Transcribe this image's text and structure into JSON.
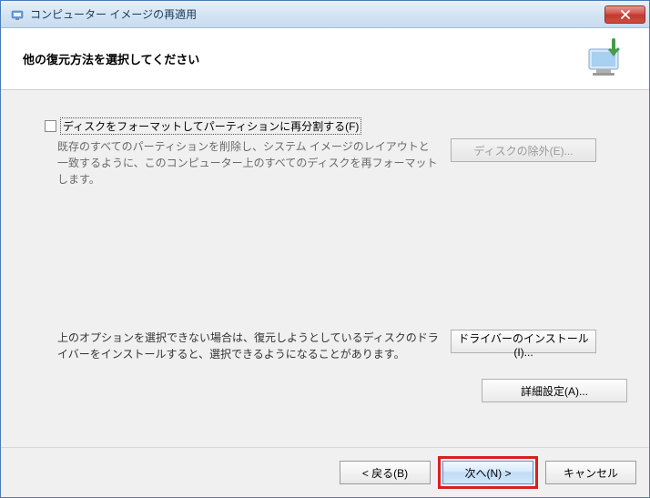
{
  "titlebar": {
    "title": "コンピューター イメージの再適用"
  },
  "header": {
    "title": "他の復元方法を選択してください"
  },
  "options": {
    "format": {
      "label": "ディスクをフォーマットしてパーティションに再分割する(F)",
      "description": "既存のすべてのパーティションを削除し、システム イメージのレイアウトと一致するように、このコンピューター上のすべてのディスクを再フォーマットします。",
      "button": "ディスクの除外(E)..."
    }
  },
  "lower": {
    "description": "上のオプションを選択できない場合は、復元しようとしているディスクのドライバーをインストールすると、選択できるようになることがあります。",
    "installButton": "ドライバーのインストール(I)...",
    "advancedButton": "詳細設定(A)..."
  },
  "footer": {
    "back": "< 戻る(B)",
    "next": "次へ(N) >",
    "cancel": "キャンセル"
  }
}
